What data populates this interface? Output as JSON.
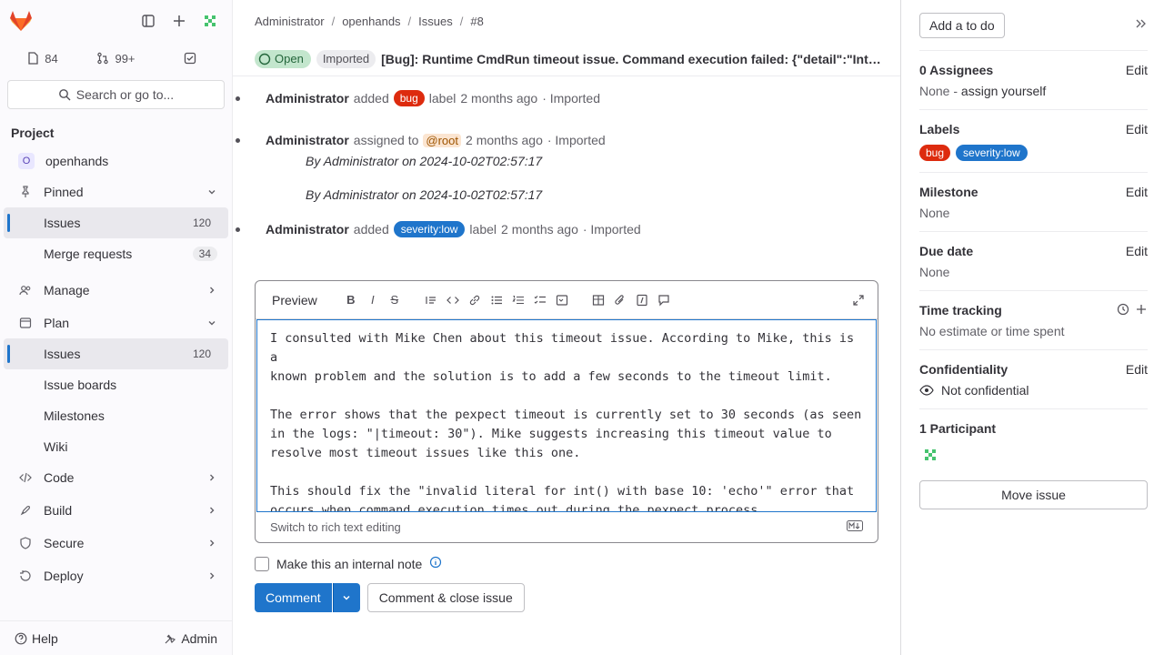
{
  "sidebar": {
    "counts": {
      "issues": "84",
      "merge_requests": "99+"
    },
    "search_label": "Search or go to...",
    "section_title": "Project",
    "project_initial": "O",
    "project_name": "openhands",
    "items": {
      "pinned": "Pinned",
      "issues_pinned": "Issues",
      "issues_pinned_count": "120",
      "merge_requests": "Merge requests",
      "merge_requests_count": "34",
      "manage": "Manage",
      "plan": "Plan",
      "issues": "Issues",
      "issues_count": "120",
      "issue_boards": "Issue boards",
      "milestones": "Milestones",
      "wiki": "Wiki",
      "code": "Code",
      "build": "Build",
      "secure": "Secure",
      "deploy": "Deploy"
    },
    "help": "Help",
    "admin": "Admin"
  },
  "breadcrumb": [
    "Administrator",
    "openhands",
    "Issues",
    "#8"
  ],
  "issue": {
    "status": "Open",
    "imported": "Imported",
    "title": "[Bug]: Runtime CmdRun timeout issue. Command execution failed: {\"detail\":\"Internal Server Error\"}"
  },
  "timeline": [
    {
      "author": "Administrator",
      "action": "added",
      "label": "bug",
      "suffix": "label",
      "time": "2 months ago",
      "imported": "· Imported"
    },
    {
      "author": "Administrator",
      "action": "assigned to",
      "assignee": "@root",
      "time": "2 months ago",
      "imported": "· Imported"
    },
    {
      "note": "By Administrator on 2024-10-02T02:57:17"
    },
    {
      "note": "By Administrator on 2024-10-02T02:57:17"
    },
    {
      "author": "Administrator",
      "action": "added",
      "label": "severity:low",
      "suffix": "label",
      "time": "2 months ago",
      "imported": "· Imported"
    }
  ],
  "editor": {
    "preview": "Preview",
    "text": "I consulted with Mike Chen about this timeout issue. According to Mike, this is a\nknown problem and the solution is to add a few seconds to the timeout limit.\n\nThe error shows that the pexpect timeout is currently set to 30 seconds (as seen\nin the logs: \"|timeout: 30\"). Mike suggests increasing this timeout value to\nresolve most timeout issues like this one.\n\nThis should fix the \"invalid literal for int() with base 10: 'echo'\" error that\noccurs when command execution times out during the pexpect process.",
    "switch_label": "Switch to rich text editing"
  },
  "internal_note_label": "Make this an internal note",
  "buttons": {
    "comment": "Comment",
    "comment_close": "Comment & close issue"
  },
  "rsidebar": {
    "todo": "Add a to do",
    "assignees_title": "0 Assignees",
    "assignees_value": "None - ",
    "assign_yourself": "assign yourself",
    "edit": "Edit",
    "labels_title": "Labels",
    "labels": [
      "bug",
      "severity:low"
    ],
    "milestone_title": "Milestone",
    "milestone_value": "None",
    "due_title": "Due date",
    "due_value": "None",
    "time_title": "Time tracking",
    "time_value": "No estimate or time spent",
    "conf_title": "Confidentiality",
    "conf_value": "Not confidential",
    "participants_title": "1 Participant",
    "move_issue": "Move issue"
  }
}
